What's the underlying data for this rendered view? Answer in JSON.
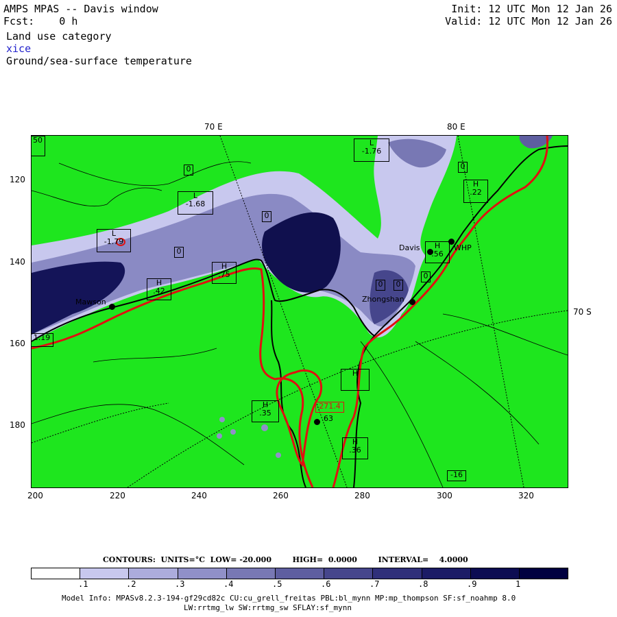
{
  "header": {
    "title": "AMPS MPAS -- Davis window",
    "fcst_label": "Fcst:",
    "fcst_value": "0 h",
    "init": "Init: 12 UTC Mon 12 Jan 26",
    "valid": "Valid: 12 UTC Mon 12 Jan 26",
    "line1": "Land use category",
    "line2": "xice",
    "line3": "Ground/sea-surface temperature"
  },
  "axes": {
    "lon_labels": [
      "70 E",
      "80 E"
    ],
    "lat_label": "70 S",
    "y_ticks": [
      "120",
      "140",
      "160",
      "180"
    ],
    "x_ticks": [
      "200",
      "220",
      "240",
      "260",
      "280",
      "300",
      "320"
    ]
  },
  "map": {
    "land_color": "#1ee61e",
    "ice_colors": [
      "#ffffff",
      "#c8c8ee",
      "#acacdc",
      "#9090c8",
      "#7878b4",
      "#5e5ea0",
      "#46468c",
      "#30307a",
      "#1c1c66",
      "#0c0c52",
      "#000040"
    ],
    "contour_labels": [
      "0",
      "0",
      "0",
      "0",
      "0",
      "0",
      "0",
      "-16"
    ],
    "hl_boxes": [
      {
        "letter": "L",
        "value": "-1.76"
      },
      {
        "letter": "H",
        "value": ".22"
      },
      {
        "letter": "L",
        "value": "-1.68"
      },
      {
        "letter": "L",
        "value": "-1.79"
      },
      {
        "letter": "H",
        "value": ".75"
      },
      {
        "letter": "H",
        "value": ".42"
      },
      {
        "letter": "H",
        "value": ".56"
      },
      {
        "letter": "H",
        "value": ""
      },
      {
        "letter": "H",
        "value": ".35"
      },
      {
        "letter": "H",
        "value": ".36"
      },
      {
        "letter": "",
        "value": "50"
      },
      {
        "letter": "",
        "value": "1.19"
      }
    ],
    "stations": [
      "Davis",
      "WHP",
      "Zhongshan",
      "Mawson"
    ],
    "special_label": "271.4",
    "special_value": "63"
  },
  "legend": {
    "contours_text": "CONTOURS:  UNITS=°C  LOW= -20.000        HIGH=  0.0000        INTERVAL=    4.0000",
    "ticks": [
      ".1",
      ".2",
      ".3",
      ".4",
      ".5",
      ".6",
      ".7",
      ".8",
      ".9",
      "1"
    ]
  },
  "footer": {
    "line1": "Model Info: MPASv8.2.3-194-gf29cd82c CU:cu_grell_freitas PBL:bl_mynn MP:mp_thompson SF:sf_noahmp 8.0",
    "line2": "LW:rrtmg_lw SW:rrtmg_sw SFLAY:sf_mynn"
  }
}
